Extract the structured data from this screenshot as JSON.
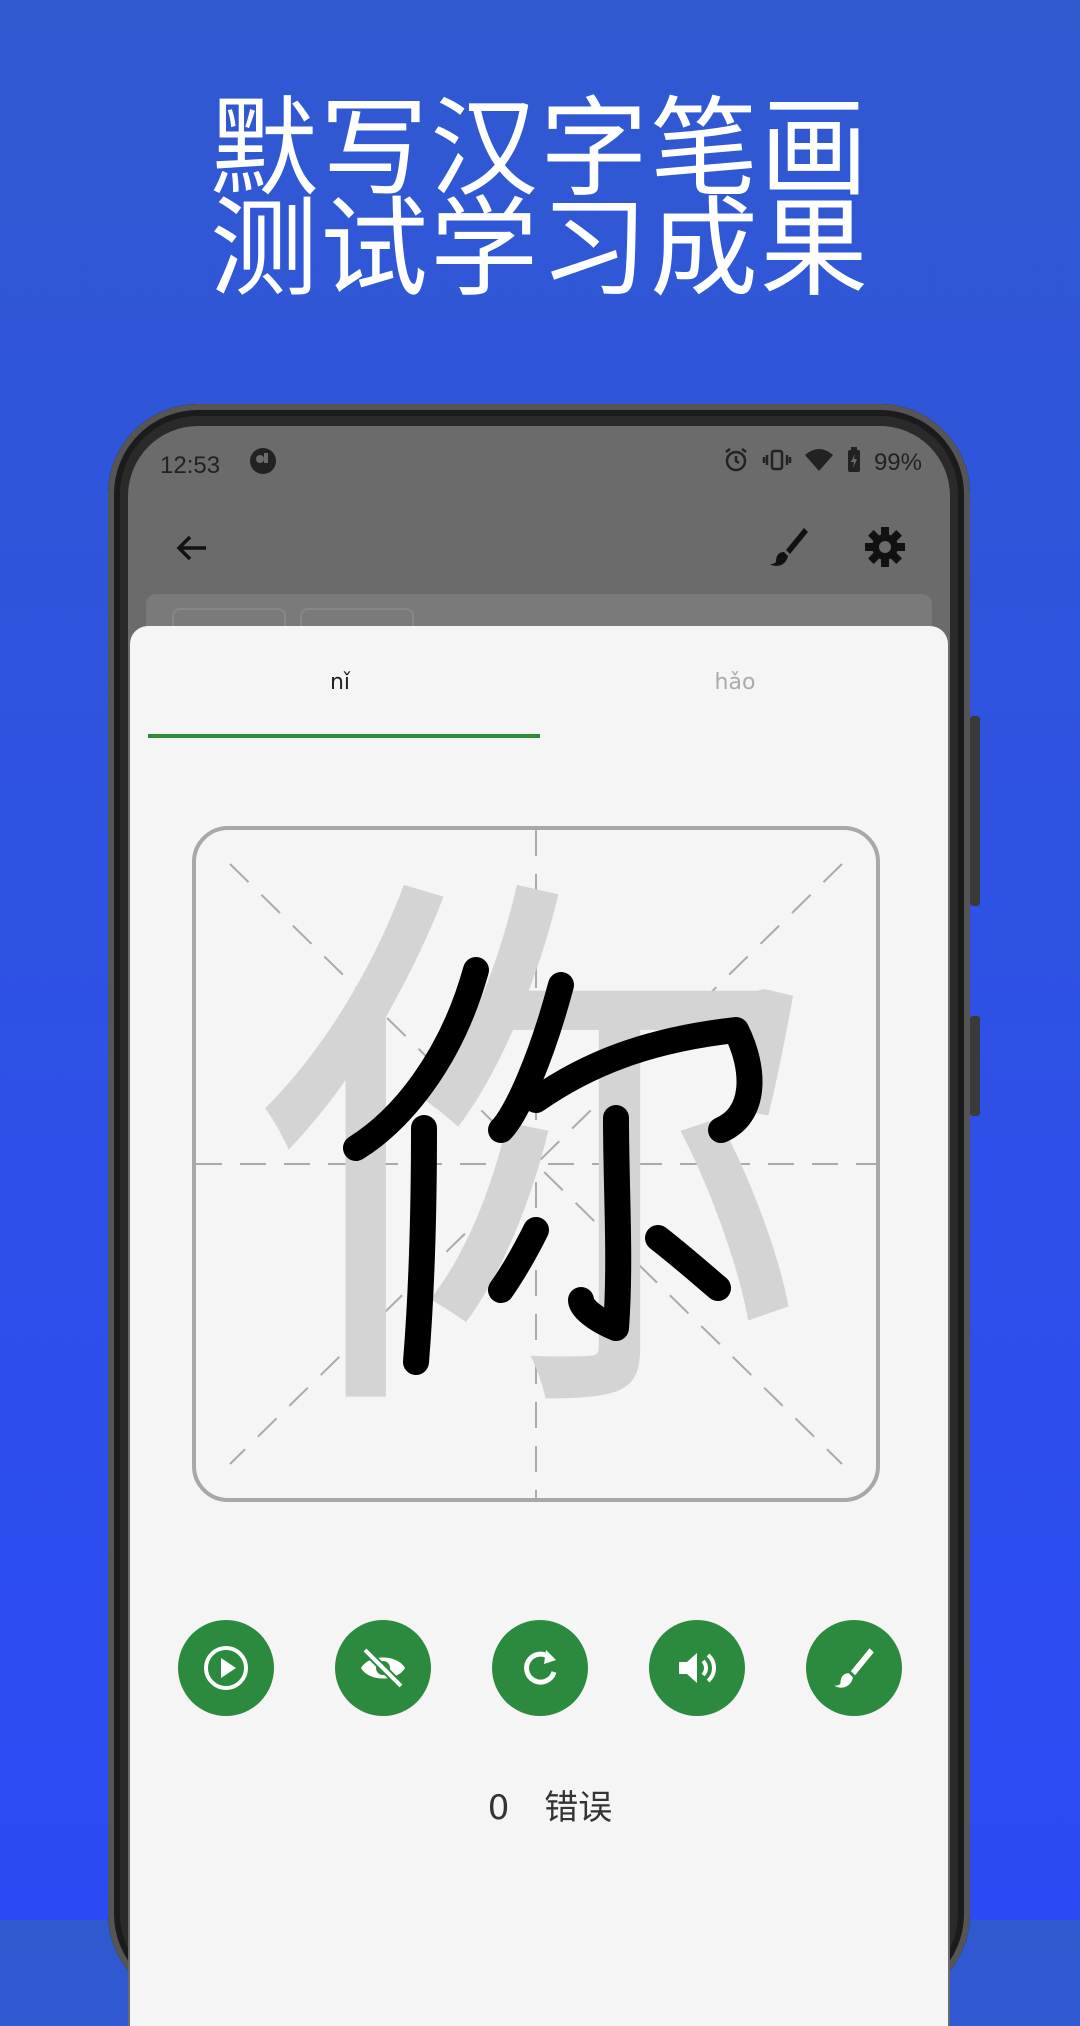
{
  "promo": {
    "line1": "默写汉字笔画",
    "line2": "测试学习成果"
  },
  "status_bar": {
    "time": "12:53",
    "battery": "99%",
    "icons": [
      "app-logo-icon",
      "alarm-icon",
      "vibrate-icon",
      "wifi-icon",
      "battery-icon"
    ]
  },
  "app_bar": {
    "icons": [
      "back-arrow-icon",
      "brush-icon",
      "gear-icon"
    ]
  },
  "tabs": [
    {
      "label": "nǐ",
      "active": true
    },
    {
      "label": "hǎo",
      "active": false
    }
  ],
  "practice": {
    "ghost_character": "你",
    "written_character": "你"
  },
  "controls": {
    "icons": [
      "play-icon",
      "eye-off-icon",
      "refresh-icon",
      "volume-icon",
      "brush-icon"
    ]
  },
  "mistakes": {
    "count": "0",
    "label": "错误"
  },
  "colors": {
    "background": "#2e50e8",
    "accent_green": "#2b8a3e",
    "tab_indicator": "#2f8a3b",
    "appbar_gray": "#6b6b6b"
  }
}
